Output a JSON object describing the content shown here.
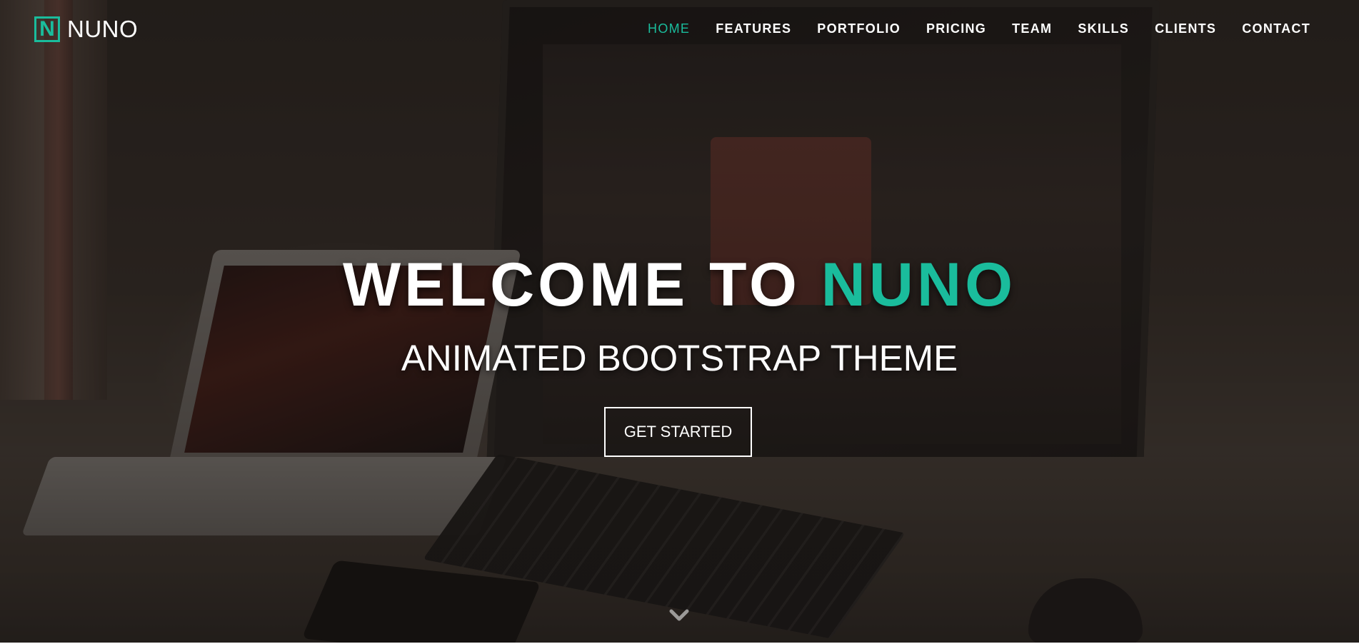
{
  "brand": {
    "logo_letter": "N",
    "name": "NUNO"
  },
  "nav": {
    "items": [
      {
        "label": "HOME",
        "active": true
      },
      {
        "label": "FEATURES",
        "active": false
      },
      {
        "label": "PORTFOLIO",
        "active": false
      },
      {
        "label": "PRICING",
        "active": false
      },
      {
        "label": "TEAM",
        "active": false
      },
      {
        "label": "SKILLS",
        "active": false
      },
      {
        "label": "CLIENTS",
        "active": false
      },
      {
        "label": "CONTACT",
        "active": false
      }
    ]
  },
  "hero": {
    "title_prefix": "WELCOME TO",
    "title_accent": "NUNO",
    "subtitle": "ANIMATED BOOTSTRAP THEME",
    "cta_label": "GET STARTED",
    "scroll_icon": "chevron-down-icon"
  },
  "colors": {
    "accent": "#1abc9c",
    "text": "#ffffff"
  }
}
